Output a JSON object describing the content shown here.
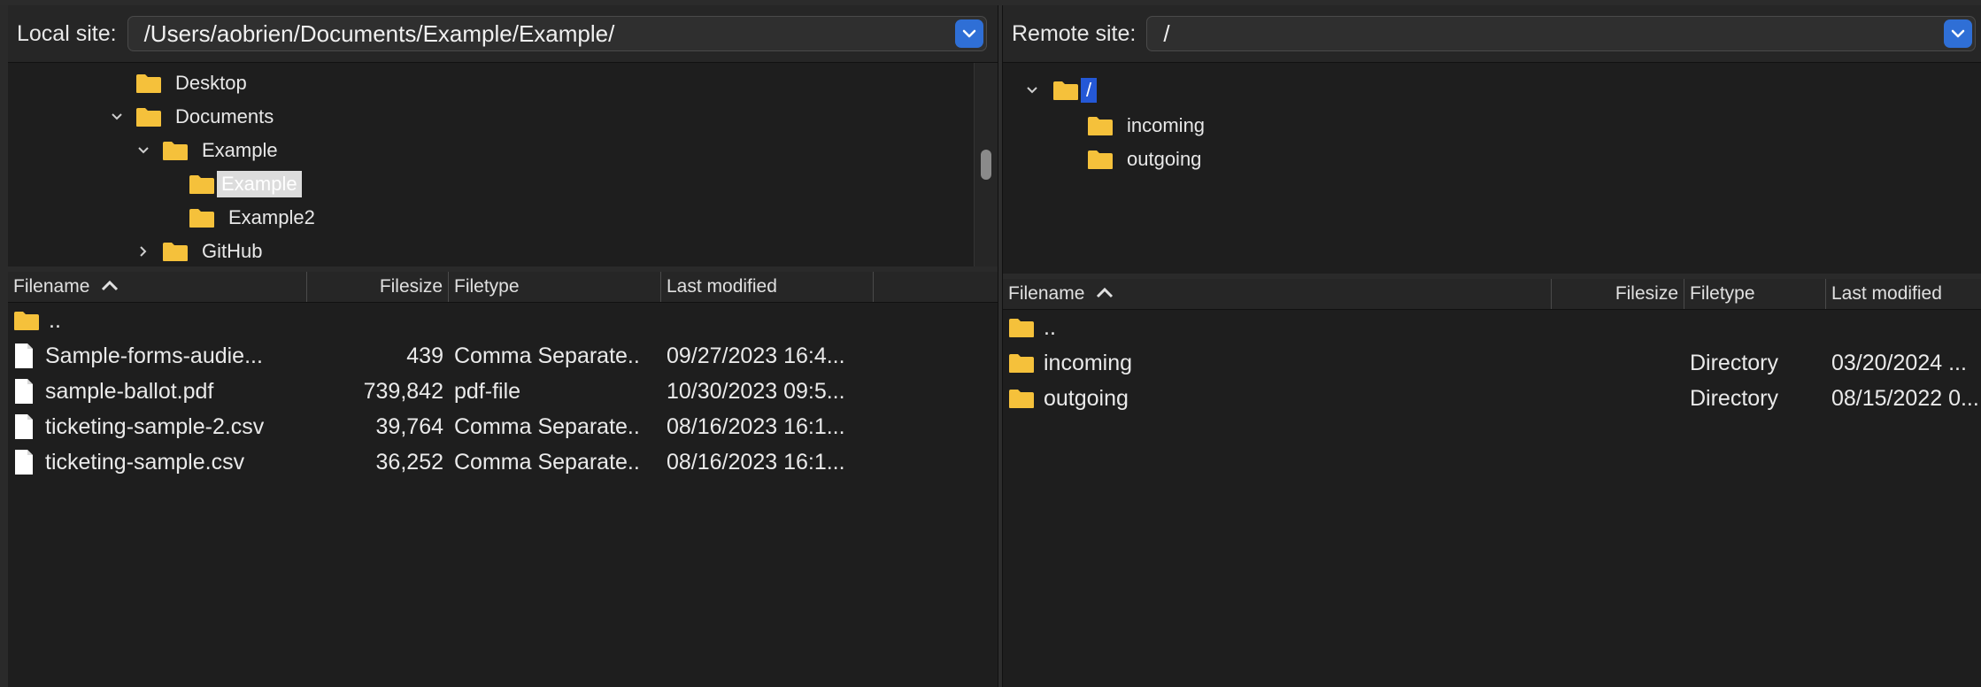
{
  "local": {
    "label": "Local site:",
    "path": "/Users/aobrien/Documents/Example/Example/",
    "tree": [
      {
        "name": "Desktop",
        "expanded": null
      },
      {
        "name": "Documents",
        "expanded": true
      },
      {
        "name": "Example",
        "expanded": true
      },
      {
        "name": "Example",
        "selected": true
      },
      {
        "name": "Example2"
      },
      {
        "name": "GitHub",
        "expanded": false
      }
    ],
    "columns": {
      "filename": "Filename",
      "filesize": "Filesize",
      "filetype": "Filetype",
      "modified": "Last modified"
    },
    "files": [
      {
        "name": "..",
        "size": "",
        "type": "",
        "modified": "",
        "kind": "folder"
      },
      {
        "name": "Sample-forms-audie...",
        "size": "439",
        "type": "Comma Separate..",
        "modified": "09/27/2023 16:4...",
        "kind": "file"
      },
      {
        "name": "sample-ballot.pdf",
        "size": "739,842",
        "type": "pdf-file",
        "modified": "10/30/2023 09:5...",
        "kind": "file"
      },
      {
        "name": "ticketing-sample-2.csv",
        "size": "39,764",
        "type": "Comma Separate..",
        "modified": "08/16/2023 16:1...",
        "kind": "file"
      },
      {
        "name": "ticketing-sample.csv",
        "size": "36,252",
        "type": "Comma Separate..",
        "modified": "08/16/2023 16:1...",
        "kind": "file"
      }
    ]
  },
  "remote": {
    "label": "Remote site:",
    "path": "/",
    "tree": [
      {
        "name": "/",
        "selected": true,
        "expanded": true
      },
      {
        "name": "incoming"
      },
      {
        "name": "outgoing"
      }
    ],
    "columns": {
      "filename": "Filename",
      "filesize": "Filesize",
      "filetype": "Filetype",
      "modified": "Last modified"
    },
    "files": [
      {
        "name": "..",
        "size": "",
        "type": "",
        "modified": "",
        "kind": "folder"
      },
      {
        "name": "incoming",
        "size": "",
        "type": "Directory",
        "modified": "03/20/2024 ...",
        "kind": "folder"
      },
      {
        "name": "outgoing",
        "size": "",
        "type": "Directory",
        "modified": "08/15/2022 0...",
        "kind": "folder"
      }
    ]
  },
  "colors": {
    "accent": "#2f6fd6",
    "folder": "#f5c13b",
    "background": "#1e1e1e"
  }
}
